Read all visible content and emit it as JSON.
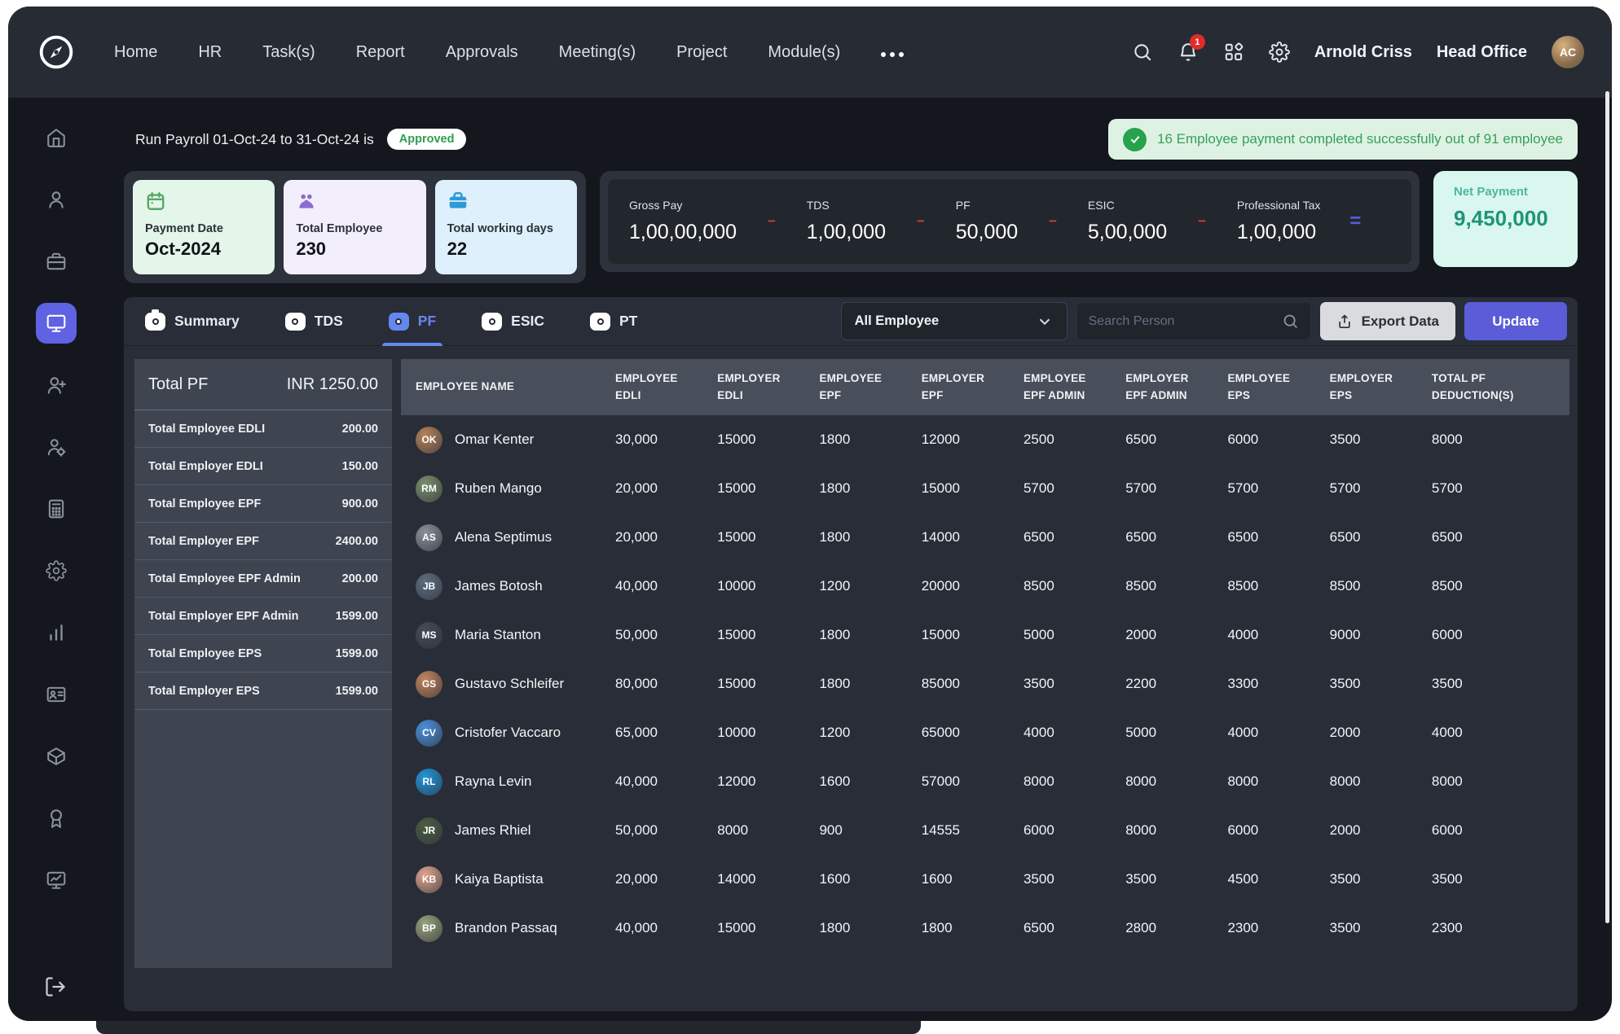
{
  "nav": {
    "items": [
      "Home",
      "HR",
      "Task(s)",
      "Report",
      "Approvals",
      "Meeting(s)",
      "Project",
      "Module(s)"
    ],
    "notification_count": "1",
    "user_name": "Arnold Criss",
    "office": "Head Office",
    "user_initials": "AC"
  },
  "banner": {
    "text": "Run Payroll 01-Oct-24 to 31-Oct-24 is",
    "status": "Approved",
    "success": "16 Employee payment completed successfully out of 91 employee"
  },
  "cards": [
    {
      "icon": "calendar-icon",
      "label": "Payment Date",
      "value": "Oct-2024",
      "bg": "#e3f6e9",
      "icon_color": "#57a766"
    },
    {
      "icon": "team-icon",
      "label": "Total Employee",
      "value": "230",
      "bg": "#f3eefb",
      "icon_color": "#8a6cd2"
    },
    {
      "icon": "briefcase-icon",
      "label": "Total working days",
      "value": "22",
      "bg": "#def0fb",
      "icon_color": "#2e9ad8"
    }
  ],
  "pay": {
    "items": [
      {
        "label": "Gross Pay",
        "value": "1,00,00,000",
        "op": "-"
      },
      {
        "label": "TDS",
        "value": "1,00,000",
        "op": "-"
      },
      {
        "label": "PF",
        "value": "50,000",
        "op": "-"
      },
      {
        "label": "ESIC",
        "value": "5,00,000",
        "op": "-"
      },
      {
        "label": "Professional Tax",
        "value": "1,00,000",
        "op": "="
      }
    ],
    "net_label": "Net Payment",
    "net_value": "9,450,000"
  },
  "tabs": [
    {
      "label": "Summary",
      "icon": "clipboard-icon",
      "active": false
    },
    {
      "label": "TDS",
      "icon": "card-icon",
      "active": false
    },
    {
      "label": "PF",
      "icon": "card-icon",
      "active": true
    },
    {
      "label": "ESIC",
      "icon": "card-icon",
      "active": false
    },
    {
      "label": "PT",
      "icon": "card-icon",
      "active": false
    }
  ],
  "controls": {
    "filter_value": "All Employee",
    "search_placeholder": "Search Person",
    "export_label": "Export Data",
    "update_label": "Update"
  },
  "pf_summary": {
    "title": "Total PF",
    "total": "INR 1250.00",
    "rows": [
      {
        "label": "Total Employee EDLI",
        "value": "200.00"
      },
      {
        "label": "Total Employer EDLI",
        "value": "150.00"
      },
      {
        "label": "Total Employee EPF",
        "value": "900.00"
      },
      {
        "label": "Total Employer EPF",
        "value": "2400.00"
      },
      {
        "label": "Total Employee EPF Admin",
        "value": "200.00"
      },
      {
        "label": "Total Employer EPF Admin",
        "value": "1599.00"
      },
      {
        "label": "Total Employee EPS",
        "value": "1599.00"
      },
      {
        "label": "Total Employer EPS",
        "value": "1599.00"
      }
    ]
  },
  "table": {
    "columns": [
      [
        "EMPLOYEE NAME"
      ],
      [
        "EMPLOYEE",
        "EDLI"
      ],
      [
        "EMPLOYER",
        "EDLI"
      ],
      [
        "EMPLOYEE",
        "EPF"
      ],
      [
        "EMPLOYER",
        "EPF"
      ],
      [
        "EMPLOYEE",
        "EPF ADMIN"
      ],
      [
        "EMPLOYER",
        "EPF ADMIN"
      ],
      [
        "EMPLOYEE",
        "EPS"
      ],
      [
        "EMPLOYER",
        "EPS"
      ],
      [
        "TOTAL PF",
        "DEDUCTION(S)"
      ]
    ],
    "rows": [
      {
        "name": "Omar Kenter",
        "values": [
          "30,000",
          "15000",
          "1800",
          "12000",
          "2500",
          "6500",
          "6000",
          "3500",
          "8000"
        ]
      },
      {
        "name": "Ruben Mango",
        "values": [
          "20,000",
          "15000",
          "1800",
          "15000",
          "5700",
          "5700",
          "5700",
          "5700",
          "5700"
        ]
      },
      {
        "name": "Alena Septimus",
        "values": [
          "20,000",
          "15000",
          "1800",
          "14000",
          "6500",
          "6500",
          "6500",
          "6500",
          "6500"
        ]
      },
      {
        "name": "James Botosh",
        "values": [
          "40,000",
          "10000",
          "1200",
          "20000",
          "8500",
          "8500",
          "8500",
          "8500",
          "8500"
        ]
      },
      {
        "name": "Maria Stanton",
        "values": [
          "50,000",
          "15000",
          "1800",
          "15000",
          "5000",
          "2000",
          "4000",
          "9000",
          "6000"
        ]
      },
      {
        "name": "Gustavo Schleifer",
        "values": [
          "80,000",
          "15000",
          "1800",
          "85000",
          "3500",
          "2200",
          "3300",
          "3500",
          "3500"
        ]
      },
      {
        "name": "Cristofer Vaccaro",
        "values": [
          "65,000",
          "10000",
          "1200",
          "65000",
          "4000",
          "5000",
          "4000",
          "2000",
          "4000"
        ]
      },
      {
        "name": "Rayna Levin",
        "values": [
          "40,000",
          "12000",
          "1600",
          "57000",
          "8000",
          "8000",
          "8000",
          "8000",
          "8000"
        ]
      },
      {
        "name": "James Rhiel",
        "values": [
          "50,000",
          "8000",
          "900",
          "14555",
          "6000",
          "8000",
          "6000",
          "2000",
          "6000"
        ]
      },
      {
        "name": "Kaiya Baptista",
        "values": [
          "20,000",
          "14000",
          "1600",
          "1600",
          "3500",
          "3500",
          "4500",
          "3500",
          "3500"
        ]
      },
      {
        "name": "Brandon Passaq",
        "values": [
          "40,000",
          "15000",
          "1800",
          "1800",
          "6500",
          "2800",
          "2300",
          "3500",
          "2300"
        ]
      }
    ]
  },
  "sidebar": {
    "items": [
      "home-icon",
      "employees-icon",
      "briefcase-icon",
      "workspace-icon",
      "add-user-icon",
      "user-settings-icon",
      "calculator-icon",
      "settings-icon",
      "bar-chart-icon",
      "id-card-icon",
      "payout-icon",
      "award-icon",
      "monitor-chart-icon"
    ],
    "active_index": 3
  },
  "colors": {
    "accent": "#5a5cd8",
    "tab_accent": "#6487f0",
    "success": "#27a24d",
    "danger": "#d83c32"
  }
}
